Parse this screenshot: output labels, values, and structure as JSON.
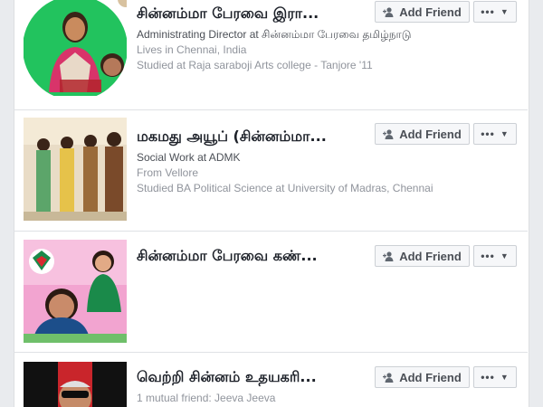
{
  "results": [
    {
      "name": "சின்னம்மா பேரவை இரா...",
      "line1": "Administrating Director at சின்னம்மா பேரவை தமிழ்நாடு",
      "line2": "Lives in Chennai, India",
      "line3": "Studied at Raja saraboji Arts college - Tanjore '11",
      "add_label": "Add Friend",
      "more_label": "•••",
      "thumb_colors": [
        "#22c35e",
        "#e8d9c8",
        "#b3242c"
      ]
    },
    {
      "name": "மகமது அயூப் (சின்னம்மா...",
      "line1": "Social Work at ADMK",
      "line2": "From Vellore",
      "line3": "Studied BA Political Science at University of Madras, Chennai",
      "add_label": "Add Friend",
      "more_label": "•••",
      "thumb_colors": [
        "#f2e8d8",
        "#9a6b3a",
        "#e6c24a"
      ]
    },
    {
      "name": "சின்னம்மா பேரவை கண்...",
      "line1": "",
      "line2": "",
      "line3": "",
      "add_label": "Add Friend",
      "more_label": "•••",
      "thumb_colors": [
        "#f2a4d0",
        "#1a8a4a",
        "#d8292f"
      ]
    },
    {
      "name": "வெற்றி சின்னம் உதயகரி...",
      "line1": "1 mutual friend: Jeeva Jeeva",
      "line2": "",
      "line3": "",
      "add_label": "Add Friend",
      "more_label": "•••",
      "thumb_colors": [
        "#1a1a1a",
        "#c9252b",
        "#e0e0e0"
      ]
    }
  ]
}
